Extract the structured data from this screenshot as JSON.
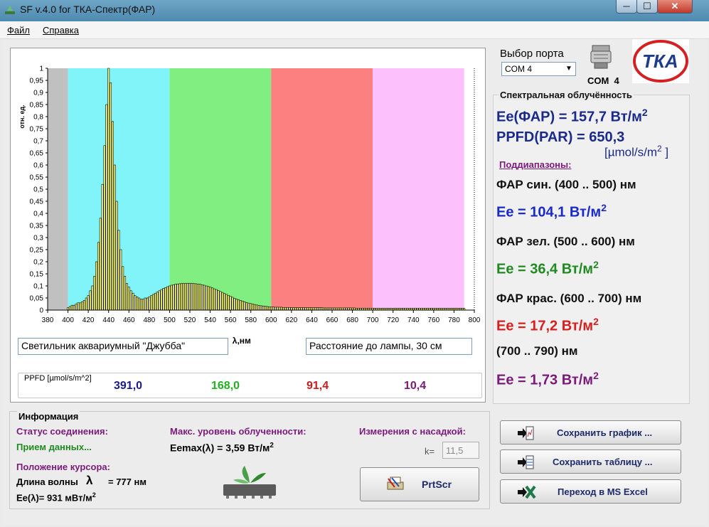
{
  "window": {
    "title": "SF v.4.0 for ТКА-Спектр(ФАР)",
    "min": "─",
    "max": "☐",
    "close": "✕"
  },
  "menu": {
    "file": "Файл",
    "help": "Справка"
  },
  "port": {
    "label": "Выбор порта",
    "selected": "COM 4",
    "status": "COM  4"
  },
  "logo": {
    "text": "ТКА"
  },
  "chart_data": {
    "type": "bar",
    "xlabel": "λ,нм",
    "ylabel": "отн. ед.",
    "xlim": [
      380,
      800
    ],
    "ylim": [
      0,
      1
    ],
    "xticks": [
      380,
      400,
      420,
      440,
      460,
      480,
      500,
      520,
      540,
      560,
      580,
      600,
      620,
      640,
      660,
      680,
      700,
      720,
      740,
      760,
      780,
      800
    ],
    "yticks": [
      "0",
      "0,05",
      "0,1",
      "0,15",
      "0,2",
      "0,25",
      "0,3",
      "0,35",
      "0,4",
      "0,45",
      "0,5",
      "0,55",
      "0,6",
      "0,65",
      "0,7",
      "0,75",
      "0,8",
      "0,85",
      "0,9",
      "0,95",
      "1"
    ],
    "bands": [
      {
        "from": 380,
        "to": 400,
        "color": "#c0c0c0"
      },
      {
        "from": 400,
        "to": 500,
        "color": "#80f4f8"
      },
      {
        "from": 500,
        "to": 600,
        "color": "#80ee80"
      },
      {
        "from": 600,
        "to": 700,
        "color": "#fd8080"
      },
      {
        "from": 700,
        "to": 790,
        "color": "#fcc0fc"
      }
    ],
    "bar_color": "#ffff80",
    "x": [
      400,
      402,
      404,
      406,
      408,
      410,
      412,
      414,
      416,
      418,
      420,
      422,
      424,
      426,
      428,
      430,
      432,
      434,
      436,
      438,
      440,
      442,
      444,
      446,
      448,
      450,
      452,
      454,
      456,
      458,
      460,
      462,
      464,
      466,
      468,
      470,
      472,
      474,
      476,
      478,
      480,
      482,
      484,
      486,
      488,
      490,
      492,
      494,
      496,
      498,
      500,
      502,
      504,
      506,
      508,
      510,
      512,
      514,
      516,
      518,
      520,
      522,
      524,
      526,
      528,
      530,
      532,
      534,
      536,
      538,
      540,
      542,
      544,
      546,
      548,
      550,
      552,
      554,
      556,
      558,
      560,
      562,
      564,
      566,
      568,
      570,
      572,
      574,
      576,
      578,
      580,
      582,
      584,
      586,
      588,
      590,
      592,
      594,
      596,
      598,
      600,
      602,
      604,
      606,
      608,
      610,
      612,
      614,
      616,
      618,
      620,
      622,
      624,
      626,
      628,
      630,
      632,
      634,
      636,
      638,
      640,
      642,
      644,
      646,
      648,
      650,
      652,
      654,
      656,
      658,
      660,
      662,
      664,
      666,
      668,
      670,
      672,
      674,
      676,
      678,
      680,
      682,
      684,
      686,
      688,
      690,
      692,
      694,
      696,
      698,
      700,
      702,
      704,
      706,
      708,
      710,
      712,
      714,
      716,
      718,
      720,
      722,
      724,
      726,
      728,
      730,
      732,
      734,
      736,
      738,
      740,
      742,
      744,
      746,
      748,
      750,
      752,
      754,
      756,
      758,
      760,
      762,
      764,
      766,
      768,
      770,
      772,
      774,
      776,
      778,
      780,
      782,
      784,
      786,
      788,
      790
    ],
    "values": [
      0.01,
      0.015,
      0.02,
      0.02,
      0.025,
      0.03,
      0.03,
      0.035,
      0.04,
      0.05,
      0.06,
      0.08,
      0.1,
      0.14,
      0.2,
      0.28,
      0.38,
      0.52,
      0.68,
      0.85,
      1.0,
      0.94,
      0.78,
      0.6,
      0.45,
      0.33,
      0.25,
      0.18,
      0.14,
      0.11,
      0.095,
      0.08,
      0.07,
      0.06,
      0.055,
      0.05,
      0.045,
      0.045,
      0.05,
      0.05,
      0.055,
      0.06,
      0.065,
      0.07,
      0.075,
      0.08,
      0.085,
      0.09,
      0.093,
      0.097,
      0.1,
      0.103,
      0.105,
      0.107,
      0.108,
      0.109,
      0.11,
      0.11,
      0.11,
      0.111,
      0.111,
      0.11,
      0.11,
      0.109,
      0.108,
      0.107,
      0.105,
      0.103,
      0.1,
      0.098,
      0.095,
      0.092,
      0.088,
      0.085,
      0.081,
      0.077,
      0.073,
      0.069,
      0.065,
      0.061,
      0.057,
      0.053,
      0.049,
      0.046,
      0.043,
      0.04,
      0.037,
      0.034,
      0.031,
      0.029,
      0.027,
      0.025,
      0.023,
      0.021,
      0.019,
      0.018,
      0.017,
      0.016,
      0.015,
      0.014,
      0.013,
      0.013,
      0.012,
      0.012,
      0.012,
      0.012,
      0.011,
      0.011,
      0.011,
      0.011,
      0.01,
      0.01,
      0.01,
      0.01,
      0.01,
      0.01,
      0.01,
      0.01,
      0.01,
      0.01,
      0.01,
      0.01,
      0.01,
      0.01,
      0.01,
      0.01,
      0.009,
      0.009,
      0.009,
      0.009,
      0.009,
      0.009,
      0.009,
      0.009,
      0.009,
      0.009,
      0.009,
      0.009,
      0.009,
      0.009,
      0.009,
      0.009,
      0.008,
      0.008,
      0.008,
      0.008,
      0.008,
      0.008,
      0.008,
      0.008,
      0.008,
      0.008,
      0.008,
      0.008,
      0.008,
      0.008,
      0.008,
      0.008,
      0.008,
      0.008,
      0.008,
      0.008,
      0.008,
      0.008,
      0.008,
      0.008,
      0.008,
      0.008,
      0.008,
      0.008,
      0.008,
      0.008,
      0.008,
      0.008,
      0.008,
      0.008,
      0.008,
      0.008,
      0.008,
      0.008,
      0.008,
      0.008,
      0.008,
      0.008,
      0.008,
      0.008,
      0.008,
      0.008,
      0.008,
      0.008,
      0.008,
      0.008,
      0.008,
      0.008,
      0.008,
      0.008,
      0.008,
      0.008,
      0.008,
      0.008,
      0.008,
      0.008,
      0.008,
      0.008
    ]
  },
  "captions": {
    "fixture": "Светильник аквариумный \"Джубба\"",
    "distance": "Расстояние до лампы, 30 см"
  },
  "ppfd": {
    "label": "PPFD [µmol/s/m^2]",
    "blue": {
      "value": "391,0",
      "color": "#1a1a8c"
    },
    "green": {
      "value": "168,0",
      "color": "#22b022"
    },
    "red": {
      "value": "91,4",
      "color": "#c81e1e"
    },
    "purple": {
      "value": "10,4",
      "color": "#7a1a7a"
    }
  },
  "spectral": {
    "header": "Спектральная облучённость",
    "ee_total": "Ee(ФАР) = 157,7 Вт/м",
    "ppfd_total": "PPFD(PAR) = 650,3",
    "ppfd_unit": "[µmol/s/m",
    "ppfd_unit_close": "]",
    "sub_header": "Поддиапазоны:",
    "blue_range": "ФАР син. (400 .. 500) нм",
    "blue_value": "Ee = 104,1 Вт/м",
    "green_range": "ФАР зел. (500 .. 600) нм",
    "green_value": "Ee = 36,4 Вт/м",
    "red_range": "ФАР крас. (600 .. 700) нм",
    "red_value": "Ee = 17,2 Вт/м",
    "ir_range": "(700 .. 790) нм",
    "ir_value": "Ee = 1,73 Вт/м",
    "exp": "2"
  },
  "info": {
    "header": "Информация",
    "status_label": "Статус соединения:",
    "status_value": "Прием данных...",
    "cursor_label": "Положение курсора:",
    "wavelength_label": "Длина волны",
    "wavelength_value": "= 777 нм",
    "ee_cursor": "Ee(λ)= 931 мВт/м",
    "max_label": "Макс. уровень облученности:",
    "max_value": "Eemax(λ) = 3,59 Вт/м",
    "attach_label": "Измерения с насадкой:",
    "k_label": "k=",
    "k_value": "11,5",
    "exp": "2"
  },
  "buttons": {
    "prtscr": "PrtScr",
    "save_chart": "Сохранить график ...",
    "save_table": "Сохранить таблицу ...",
    "excel": "Переход в MS Excel"
  }
}
